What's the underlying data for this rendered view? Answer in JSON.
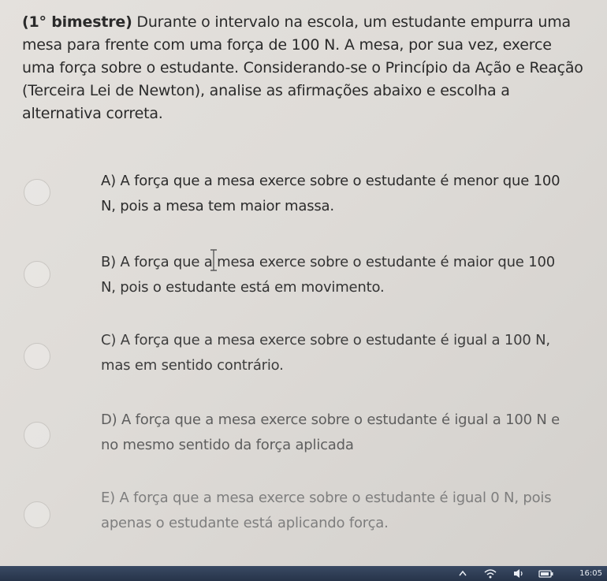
{
  "question": {
    "prefix": "(1° bimestre)",
    "text": " Durante o intervalo na escola, um estudante empurra uma mesa para frente com uma força de 100 N. A mesa, por sua vez, exerce uma força sobre o estudante. Considerando-se o Princípio da Ação e Reação (Terceira Lei de Newton), analise as afirmações abaixo e escolha a alternativa correta."
  },
  "options": [
    {
      "label": "A) A força que a mesa exerce sobre o estudante é menor que 100 N, pois a mesa tem maior massa."
    },
    {
      "label": "B) A força que a mesa exerce sobre o estudante é maior que 100 N, pois o estudante está em movimento."
    },
    {
      "label": "C) A força que a mesa exerce sobre o estudante é igual a 100 N, mas em sentido contrário."
    },
    {
      "label": "D) A força que a mesa exerce sobre o estudante é igual a 100 N e no mesmo sentido da força aplicada"
    },
    {
      "label": "E) A força que a mesa exerce sobre o estudante é igual 0 N, pois apenas o estudante está aplicando força."
    }
  ],
  "taskbar": {
    "icons": [
      "chevron-up-icon",
      "wifi-icon",
      "speaker-icon",
      "battery-icon"
    ],
    "clock": "16:05"
  }
}
